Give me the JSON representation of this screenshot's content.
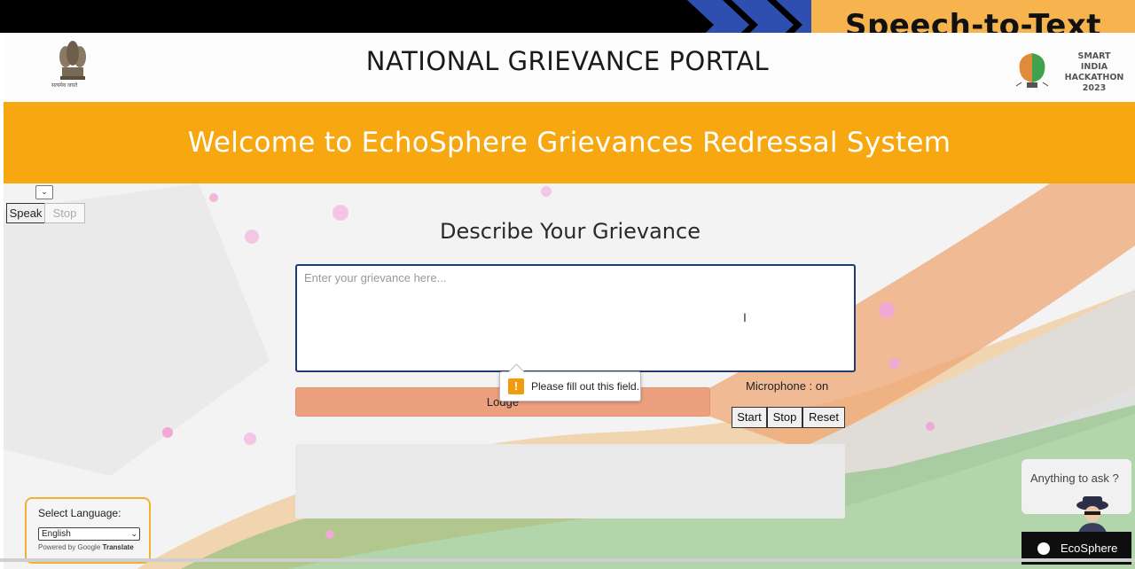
{
  "banner": {
    "label": "Speech-to-Text",
    "colors": {
      "accent": "#f6b34e",
      "chevron": "#2f4fb0"
    }
  },
  "header": {
    "emblem_motto": "सत्यमेव जयते",
    "title": "NATIONAL GRIEVANCE PORTAL",
    "sih_logo": {
      "icon": "sih-brain-bulb-icon",
      "lines": [
        "SMART INDIA",
        "HACKATHON",
        "2023"
      ]
    }
  },
  "welcome": {
    "text": "Welcome to EchoSphere Grievances Redressal System",
    "color": "#f7a710"
  },
  "speech_controls": {
    "select_arrow": "⌄",
    "speak_label": "Speak",
    "stop_label": "Stop"
  },
  "form": {
    "heading": "Describe Your Grievance",
    "textarea_value": "",
    "textarea_placeholder": "Enter your grievance here...",
    "lodge_label": "Lodge",
    "lodge_color": "#eca07e",
    "validation_tooltip": {
      "icon": "warning-icon",
      "text": "Please fill out this field."
    },
    "microphone_status": "Microphone : on",
    "buttons": {
      "start": "Start",
      "stop": "Stop",
      "reset": "Reset"
    }
  },
  "language_widget": {
    "label": "Select Language:",
    "selected": "English",
    "powered_by_prefix": "Powered by",
    "powered_by_brand": "Google",
    "powered_by_suffix": "Translate"
  },
  "chat": {
    "prompt": "Anything to ask ?",
    "avatar_icon": "spy-avatar-icon",
    "brand": "EcoSphere"
  }
}
